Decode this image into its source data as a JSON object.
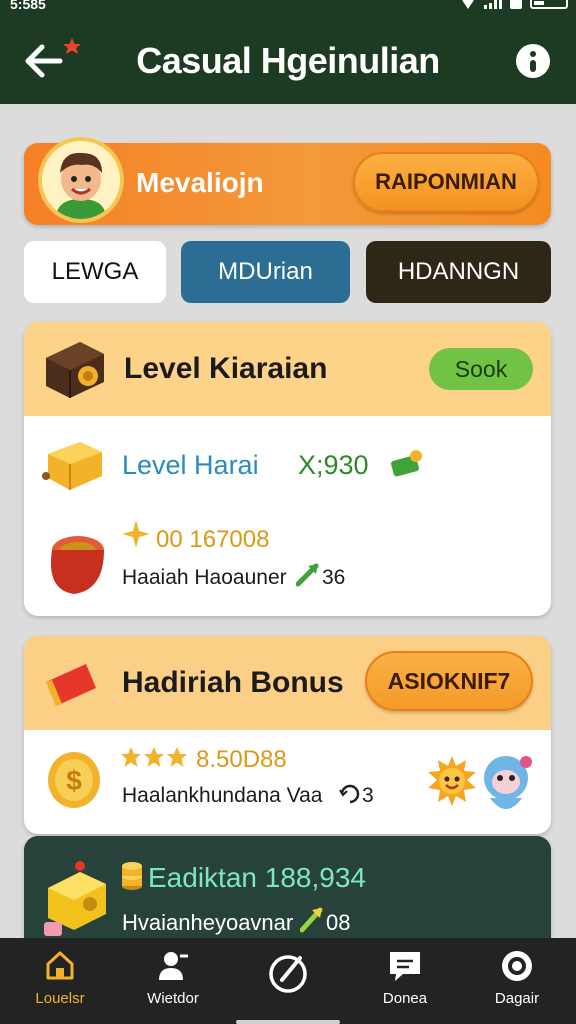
{
  "status": {
    "time": "5:585"
  },
  "appbar": {
    "title": "Casual Hgeinulian",
    "back_icon": "back-arrow-icon",
    "info_icon": "info-icon"
  },
  "profile": {
    "name": "Mevaliojn",
    "button": "RAIPONMIAN"
  },
  "tabs": [
    {
      "label": "LEWGA"
    },
    {
      "label": "MDUrian"
    },
    {
      "label": "HDANNGN"
    }
  ],
  "card1": {
    "title": "Level Kiaraian",
    "badge": "Sook",
    "row1": {
      "label": "Level Harai",
      "value": "X;930"
    },
    "row2": {
      "amount": "00 167008",
      "desc": "Haaiah Haoauner",
      "desc_suffix": "36"
    }
  },
  "card2": {
    "title": "Hadiriah Bonus",
    "button": "ASIOKNIF7",
    "rating": "8.50D88",
    "desc": "Haalankhundana Vaa",
    "desc_suffix": "3"
  },
  "card3": {
    "title": "Eadiktan 188,934",
    "desc": "Hvaianheyoavnar",
    "desc_suffix": "08"
  },
  "nav": [
    {
      "label": "Louelsr",
      "icon": "home-icon"
    },
    {
      "label": "Wietdor",
      "icon": "user-icon"
    },
    {
      "label": "",
      "icon": "compass-icon"
    },
    {
      "label": "Donea",
      "icon": "chat-icon"
    },
    {
      "label": "Dagair",
      "icon": "settings-icon"
    }
  ],
  "colors": {
    "appbar": "#1d3b22",
    "accent_orange": "#f57f26",
    "tab_blue": "#2c6d93",
    "tab_dark": "#2e2617",
    "green_text": "#2f8a2a",
    "blue_text": "#2a8bbf",
    "gold": "#d99a16"
  }
}
